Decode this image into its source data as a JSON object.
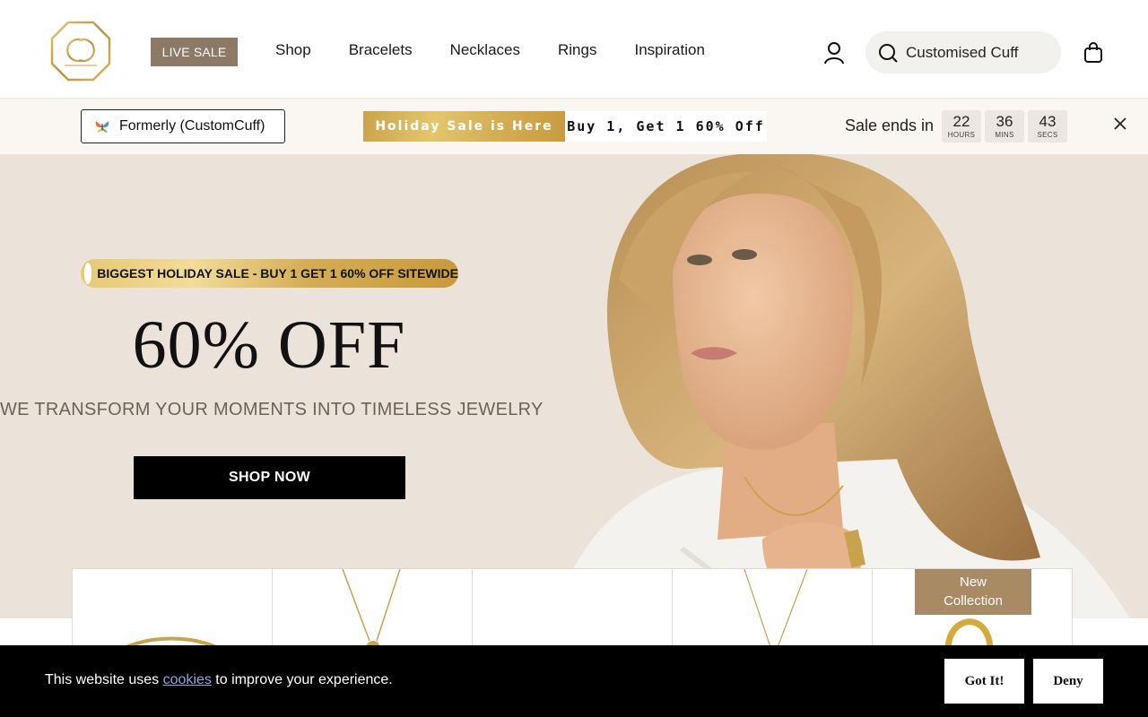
{
  "header": {
    "logo_icon": "interlocking-c-logo",
    "live_sale_label": "LIVE SALE",
    "nav": [
      "Shop",
      "Bracelets",
      "Necklaces",
      "Rings",
      "Inspiration"
    ],
    "account_icon": "user-icon",
    "search": {
      "icon": "search-icon",
      "text": "Customised Cuff"
    },
    "cart_icon": "shopping-bag-icon"
  },
  "promo": {
    "formerly_icon": "butterfly-icon",
    "formerly_label": "Formerly (CustomCuff)",
    "holiday_gold_text": "Holiday Sale is Here",
    "holiday_offer_text": "Buy 1, Get 1 60% Off",
    "sale_ends_label": "Sale ends in",
    "countdown": [
      {
        "value": "22",
        "unit": "HOURS"
      },
      {
        "value": "36",
        "unit": "MINS"
      },
      {
        "value": "43",
        "unit": "SECS"
      }
    ],
    "close_icon": "close-icon"
  },
  "hero": {
    "badge_text": "BIGGEST HOLIDAY SALE - BUY 1 GET 1 60% OFF SITEWIDE",
    "title": "60% OFF",
    "subtitle": "WE TRANSFORM YOUR MOMENTS INTO TIMELESS JEWELRY",
    "cta_label": "SHOP NOW"
  },
  "products": {
    "new_tag_line1": "New",
    "new_tag_line2": "Collection"
  },
  "cookie": {
    "text_before": "This website uses ",
    "link_text": "cookies",
    "text_after": " to improve your experience.",
    "accept_label": "Got It!",
    "deny_label": "Deny"
  },
  "colors": {
    "accent_brown": "#8c7a66",
    "hero_bg": "#ebe3da",
    "gold": "#d6b25a",
    "new_tag": "#a88a64"
  }
}
